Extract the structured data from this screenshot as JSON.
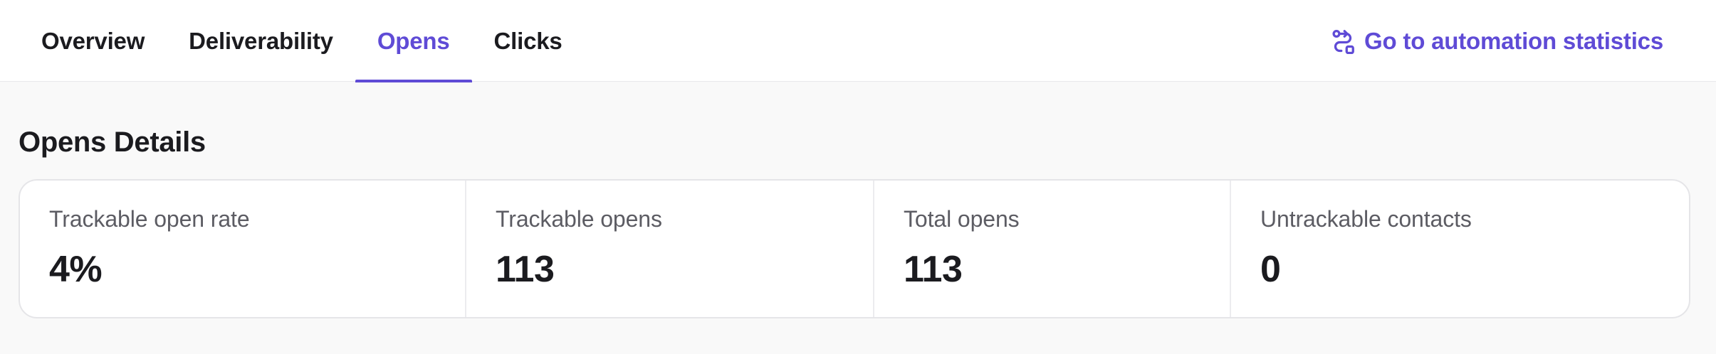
{
  "tabs": [
    {
      "label": "Overview",
      "active": false
    },
    {
      "label": "Deliverability",
      "active": false
    },
    {
      "label": "Opens",
      "active": true
    },
    {
      "label": "Clicks",
      "active": false
    }
  ],
  "automation_link": {
    "label": "Go to automation statistics",
    "icon": "automation-icon"
  },
  "section": {
    "title": "Opens Details"
  },
  "stats": [
    {
      "label": "Trackable open rate",
      "value": "4%"
    },
    {
      "label": "Trackable opens",
      "value": "113"
    },
    {
      "label": "Total opens",
      "value": "113"
    },
    {
      "label": "Untrackable contacts",
      "value": "0"
    }
  ],
  "colors": {
    "accent": "#5f4bd6",
    "text": "#1b1b1f",
    "muted": "#5c5c63",
    "background": "#f9f9f9"
  }
}
